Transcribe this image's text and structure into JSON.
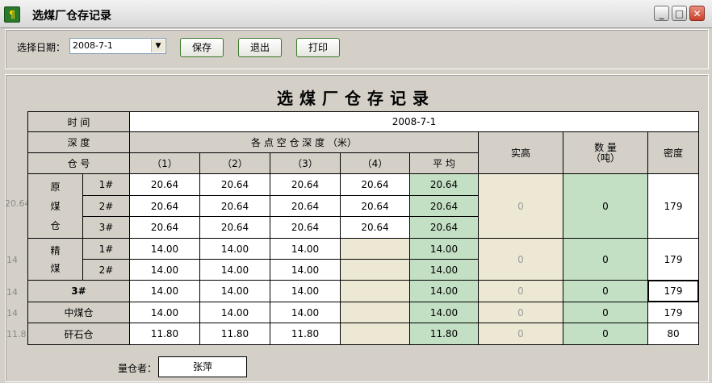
{
  "window": {
    "title": "选煤厂仓存记录",
    "btn_min": "_",
    "btn_max": "□",
    "btn_close": "✕"
  },
  "toolbar": {
    "date_label": "选择日期：",
    "date_value": "2008-7-1",
    "save": "保存",
    "exit": "退出",
    "print": "打印"
  },
  "report": {
    "title": "选煤厂仓存记录",
    "time_label": "时  间",
    "time_value": "2008-7-1",
    "depth_label": "深  度",
    "depth_group": "各 点 空 仓 深 度 （米）",
    "bin_label": "仓  号",
    "columns": [
      "（1）",
      "（2）",
      "（3）",
      "（4）",
      "平  均"
    ],
    "actual_height": "实高",
    "quantity_line1": "数    量",
    "quantity_line2": "（吨）",
    "density": "密度",
    "groups": {
      "raw": {
        "name": [
          "原",
          "煤",
          "仓"
        ],
        "side_value": "20.64",
        "actual": "0",
        "quantity": "0",
        "density": "179",
        "rows": [
          {
            "no": "1#",
            "v": [
              "20.64",
              "20.64",
              "20.64",
              "20.64",
              "20.64"
            ]
          },
          {
            "no": "2#",
            "v": [
              "20.64",
              "20.64",
              "20.64",
              "20.64",
              "20.64"
            ]
          },
          {
            "no": "3#",
            "v": [
              "20.64",
              "20.64",
              "20.64",
              "20.64",
              "20.64"
            ]
          }
        ]
      },
      "clean": {
        "name": [
          "精",
          "煤"
        ],
        "side_value": "14",
        "actual": "0",
        "quantity": "0",
        "density": "179",
        "rows": [
          {
            "no": "1#",
            "v": [
              "14.00",
              "14.00",
              "14.00",
              "",
              "14.00"
            ]
          },
          {
            "no": "2#",
            "v": [
              "14.00",
              "14.00",
              "14.00",
              "",
              "14.00"
            ]
          }
        ]
      },
      "bin3": {
        "name": "3#",
        "side_value": "14",
        "v": [
          "14.00",
          "14.00",
          "14.00",
          "",
          "14.00"
        ],
        "actual": "0",
        "quantity": "0",
        "density": "179"
      },
      "middling": {
        "name": "中煤仓",
        "side_value": "14",
        "v": [
          "14.00",
          "14.00",
          "14.00",
          "",
          "14.00"
        ],
        "actual": "0",
        "quantity": "0",
        "density": "179"
      },
      "gangue": {
        "name": "矸石仓",
        "side_value": "11.8",
        "v": [
          "11.80",
          "11.80",
          "11.80",
          "",
          "11.80"
        ],
        "actual": "0",
        "quantity": "0",
        "density": "80"
      }
    },
    "keeper_label": "量仓者：",
    "keeper_value": "张萍"
  },
  "colors": {
    "average_bg": "#c4e0c4",
    "readonly_bg": "#ede8d4",
    "quantity_bg": "#c4e0c4",
    "window_bg": "#d4d0c8"
  }
}
